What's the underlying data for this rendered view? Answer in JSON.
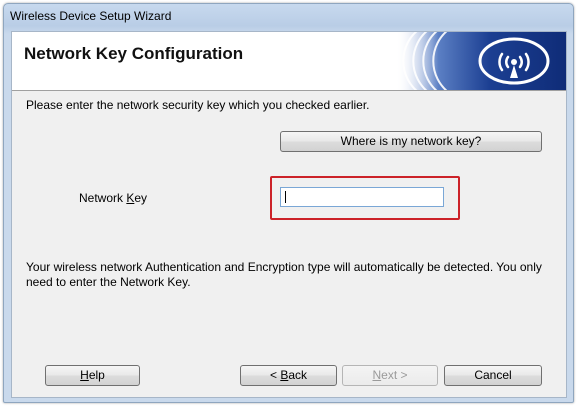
{
  "window": {
    "title": "Wireless Device Setup Wizard"
  },
  "header": {
    "title": "Network Key Configuration",
    "graphic_icon": "wireless-signal-icon"
  },
  "instructions": "Please enter the network security key which you checked earlier.",
  "help_link_button": "Where is my network key?",
  "network_key": {
    "label_pre": "Network ",
    "label_mnemonic": "K",
    "label_post": "ey",
    "value": ""
  },
  "info_text": "Your wireless network Authentication and Encryption type will automatically be detected. You only need to enter the Network Key.",
  "footer": {
    "help": {
      "mnemonic": "H",
      "rest": "elp"
    },
    "back": {
      "pre": "< ",
      "mnemonic": "B",
      "rest": "ack"
    },
    "next": {
      "mnemonic": "N",
      "rest": "ext >"
    },
    "cancel": "Cancel"
  },
  "colors": {
    "highlight_border": "#cc2229",
    "header_accent": "#1a3f8f"
  }
}
